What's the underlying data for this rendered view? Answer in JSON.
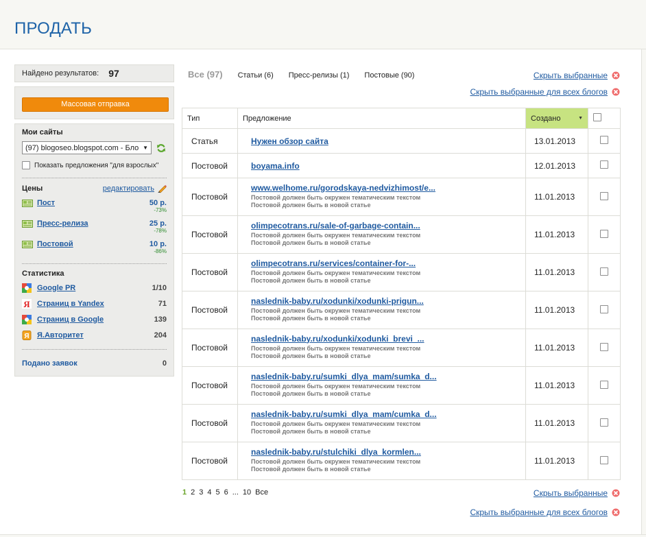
{
  "page": {
    "title": "ПРОДАТЬ"
  },
  "sidebar": {
    "found_label": "Найдено результатов:",
    "found_count": "97",
    "mass_send_label": "Массовая отправка",
    "my_sites_label": "Мои сайты",
    "site_select_value": "(97) blogoseo.blogspot.com - Бло",
    "adult_label": "Показать предложения \"для взрослых\"",
    "prices_label": "Цены",
    "edit_label": "редактировать",
    "prices": [
      {
        "label": "Пост",
        "value": "50 р.",
        "pct": "-73%"
      },
      {
        "label": "Пресс-релиза",
        "value": "25 р.",
        "pct": "-78%"
      },
      {
        "label": "Постовой",
        "value": "10 р.",
        "pct": "-86%"
      }
    ],
    "stats_label": "Статистика",
    "stats": [
      {
        "label": "Google PR",
        "value": "1/10",
        "icon": "google-icon"
      },
      {
        "label": "Страниц в Yandex",
        "value": "71",
        "icon": "yandex-icon"
      },
      {
        "label": "Страниц в Google",
        "value": "139",
        "icon": "google-icon"
      },
      {
        "label": "Я.Авторитет",
        "value": "204",
        "icon": "ya-authority-icon"
      }
    ],
    "applications_label": "Подано заявок",
    "applications_value": "0"
  },
  "tabs": [
    {
      "label": "Все (97)",
      "active": true
    },
    {
      "label": "Статьи (6)"
    },
    {
      "label": "Пресс-релизы (1)"
    },
    {
      "label": "Постовые (90)"
    }
  ],
  "actions": {
    "hide_selected": "Скрыть выбранные",
    "hide_selected_all": "Скрыть выбранные для всех блогов"
  },
  "table": {
    "headers": {
      "type": "Тип",
      "offer": "Предложение",
      "created": "Создано"
    },
    "note_line1": "Постовой должен быть окружен тематическим текстом",
    "note_line2": "Постовой должен быть в новой статье",
    "rows": [
      {
        "type": "Статья",
        "title": "Нужен обзор сайта",
        "date": "13.01.2013"
      },
      {
        "type": "Постовой",
        "title": "boyama.info",
        "date": "12.01.2013"
      },
      {
        "type": "Постовой",
        "title": "www.welhome.ru/gorodskaya-nedvizhimost/e...",
        "date": "11.01.2013"
      },
      {
        "type": "Постовой",
        "title": "olimpecotrans.ru/sale-of-garbage-contain...",
        "date": "11.01.2013"
      },
      {
        "type": "Постовой",
        "title": "olimpecotrans.ru/services/container-for-...",
        "date": "11.01.2013"
      },
      {
        "type": "Постовой",
        "title": "naslednik-baby.ru/xodunki/xodunki-prigun...",
        "date": "11.01.2013"
      },
      {
        "type": "Постовой",
        "title": "naslednik-baby.ru/xodunki/xodunki_brevi_...",
        "date": "11.01.2013"
      },
      {
        "type": "Постовой",
        "title": "naslednik-baby.ru/sumki_dlya_mam/sumka_d...",
        "date": "11.01.2013"
      },
      {
        "type": "Постовой",
        "title": "naslednik-baby.ru/sumki_dlya_mam/cumka_d...",
        "date": "11.01.2013"
      },
      {
        "type": "Постовой",
        "title": "naslednik-baby.ru/stulchiki_dlya_kormlen...",
        "date": "11.01.2013"
      }
    ]
  },
  "pagination": {
    "pages": [
      "1",
      "2",
      "3",
      "4",
      "5",
      "6",
      "...",
      "10",
      "Все"
    ],
    "current": "1"
  },
  "colors": {
    "accent_blue": "#1e63a8",
    "link": "#1f5aa0",
    "orange_button": "#f08a0c",
    "sort_header": "#c7e381",
    "remove_red": "#e0474c",
    "pct_green": "#2e8b2e"
  }
}
